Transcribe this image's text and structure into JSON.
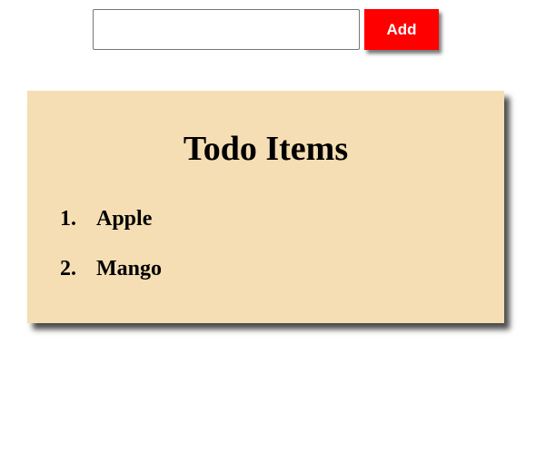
{
  "form": {
    "input_value": "",
    "input_placeholder": "",
    "add_label": "Add"
  },
  "card": {
    "title": "Todo Items",
    "items": [
      {
        "number": "1.",
        "label": "Apple"
      },
      {
        "number": "2.",
        "label": "Mango"
      }
    ]
  },
  "colors": {
    "button_bg": "#ff0000",
    "button_text": "#ffffff",
    "card_bg": "#f5deb3",
    "text": "#000000"
  }
}
